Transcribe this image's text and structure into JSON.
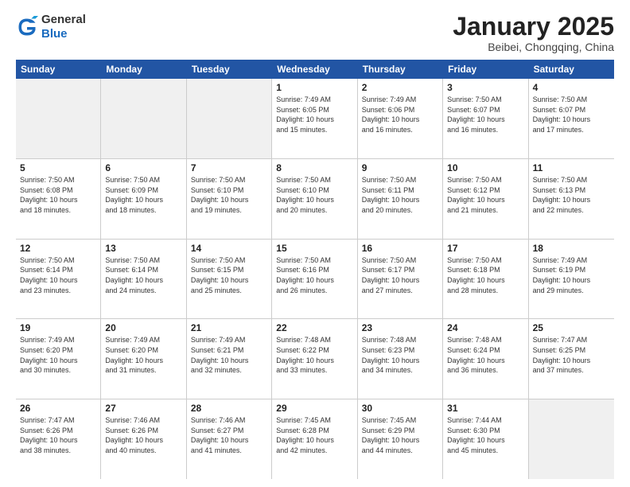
{
  "logo": {
    "general": "General",
    "blue": "Blue"
  },
  "title": "January 2025",
  "subtitle": "Beibei, Chongqing, China",
  "headers": [
    "Sunday",
    "Monday",
    "Tuesday",
    "Wednesday",
    "Thursday",
    "Friday",
    "Saturday"
  ],
  "weeks": [
    [
      {
        "day": "",
        "info": "",
        "shaded": true
      },
      {
        "day": "",
        "info": "",
        "shaded": true
      },
      {
        "day": "",
        "info": "",
        "shaded": true
      },
      {
        "day": "1",
        "info": "Sunrise: 7:49 AM\nSunset: 6:05 PM\nDaylight: 10 hours\nand 15 minutes."
      },
      {
        "day": "2",
        "info": "Sunrise: 7:49 AM\nSunset: 6:06 PM\nDaylight: 10 hours\nand 16 minutes."
      },
      {
        "day": "3",
        "info": "Sunrise: 7:50 AM\nSunset: 6:07 PM\nDaylight: 10 hours\nand 16 minutes."
      },
      {
        "day": "4",
        "info": "Sunrise: 7:50 AM\nSunset: 6:07 PM\nDaylight: 10 hours\nand 17 minutes."
      }
    ],
    [
      {
        "day": "5",
        "info": "Sunrise: 7:50 AM\nSunset: 6:08 PM\nDaylight: 10 hours\nand 18 minutes."
      },
      {
        "day": "6",
        "info": "Sunrise: 7:50 AM\nSunset: 6:09 PM\nDaylight: 10 hours\nand 18 minutes."
      },
      {
        "day": "7",
        "info": "Sunrise: 7:50 AM\nSunset: 6:10 PM\nDaylight: 10 hours\nand 19 minutes."
      },
      {
        "day": "8",
        "info": "Sunrise: 7:50 AM\nSunset: 6:10 PM\nDaylight: 10 hours\nand 20 minutes."
      },
      {
        "day": "9",
        "info": "Sunrise: 7:50 AM\nSunset: 6:11 PM\nDaylight: 10 hours\nand 20 minutes."
      },
      {
        "day": "10",
        "info": "Sunrise: 7:50 AM\nSunset: 6:12 PM\nDaylight: 10 hours\nand 21 minutes."
      },
      {
        "day": "11",
        "info": "Sunrise: 7:50 AM\nSunset: 6:13 PM\nDaylight: 10 hours\nand 22 minutes."
      }
    ],
    [
      {
        "day": "12",
        "info": "Sunrise: 7:50 AM\nSunset: 6:14 PM\nDaylight: 10 hours\nand 23 minutes."
      },
      {
        "day": "13",
        "info": "Sunrise: 7:50 AM\nSunset: 6:14 PM\nDaylight: 10 hours\nand 24 minutes."
      },
      {
        "day": "14",
        "info": "Sunrise: 7:50 AM\nSunset: 6:15 PM\nDaylight: 10 hours\nand 25 minutes."
      },
      {
        "day": "15",
        "info": "Sunrise: 7:50 AM\nSunset: 6:16 PM\nDaylight: 10 hours\nand 26 minutes."
      },
      {
        "day": "16",
        "info": "Sunrise: 7:50 AM\nSunset: 6:17 PM\nDaylight: 10 hours\nand 27 minutes."
      },
      {
        "day": "17",
        "info": "Sunrise: 7:50 AM\nSunset: 6:18 PM\nDaylight: 10 hours\nand 28 minutes."
      },
      {
        "day": "18",
        "info": "Sunrise: 7:49 AM\nSunset: 6:19 PM\nDaylight: 10 hours\nand 29 minutes."
      }
    ],
    [
      {
        "day": "19",
        "info": "Sunrise: 7:49 AM\nSunset: 6:20 PM\nDaylight: 10 hours\nand 30 minutes."
      },
      {
        "day": "20",
        "info": "Sunrise: 7:49 AM\nSunset: 6:20 PM\nDaylight: 10 hours\nand 31 minutes."
      },
      {
        "day": "21",
        "info": "Sunrise: 7:49 AM\nSunset: 6:21 PM\nDaylight: 10 hours\nand 32 minutes."
      },
      {
        "day": "22",
        "info": "Sunrise: 7:48 AM\nSunset: 6:22 PM\nDaylight: 10 hours\nand 33 minutes."
      },
      {
        "day": "23",
        "info": "Sunrise: 7:48 AM\nSunset: 6:23 PM\nDaylight: 10 hours\nand 34 minutes."
      },
      {
        "day": "24",
        "info": "Sunrise: 7:48 AM\nSunset: 6:24 PM\nDaylight: 10 hours\nand 36 minutes."
      },
      {
        "day": "25",
        "info": "Sunrise: 7:47 AM\nSunset: 6:25 PM\nDaylight: 10 hours\nand 37 minutes."
      }
    ],
    [
      {
        "day": "26",
        "info": "Sunrise: 7:47 AM\nSunset: 6:26 PM\nDaylight: 10 hours\nand 38 minutes."
      },
      {
        "day": "27",
        "info": "Sunrise: 7:46 AM\nSunset: 6:26 PM\nDaylight: 10 hours\nand 40 minutes."
      },
      {
        "day": "28",
        "info": "Sunrise: 7:46 AM\nSunset: 6:27 PM\nDaylight: 10 hours\nand 41 minutes."
      },
      {
        "day": "29",
        "info": "Sunrise: 7:45 AM\nSunset: 6:28 PM\nDaylight: 10 hours\nand 42 minutes."
      },
      {
        "day": "30",
        "info": "Sunrise: 7:45 AM\nSunset: 6:29 PM\nDaylight: 10 hours\nand 44 minutes."
      },
      {
        "day": "31",
        "info": "Sunrise: 7:44 AM\nSunset: 6:30 PM\nDaylight: 10 hours\nand 45 minutes."
      },
      {
        "day": "",
        "info": "",
        "shaded": true
      }
    ]
  ]
}
